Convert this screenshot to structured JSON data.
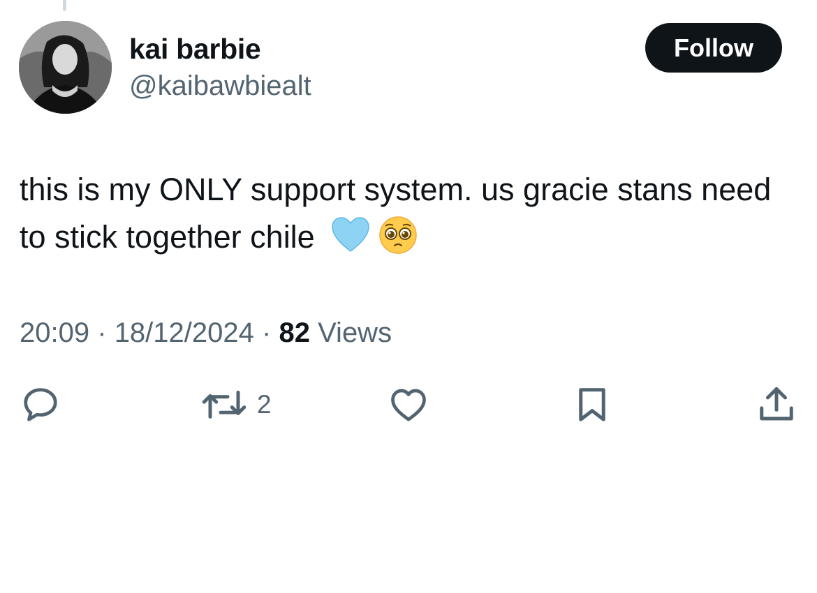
{
  "tweet": {
    "author": {
      "display_name": "kai barbie",
      "handle": "@kaibawbiealt"
    },
    "follow_button_label": "Follow",
    "text": "this is my ONLY support system. us gracie stans need to stick together chile",
    "emojis": [
      "light-blue-heart",
      "pleading-face"
    ],
    "time": "20:09",
    "separator": "·",
    "date": "18/12/2024",
    "views_count": "82",
    "views_label": "Views"
  },
  "actions": {
    "reply_icon": "reply-icon",
    "retweet_icon": "retweet-icon",
    "retweet_count": "2",
    "like_icon": "heart-icon",
    "bookmark_icon": "bookmark-icon",
    "share_icon": "share-icon"
  },
  "colors": {
    "text_primary": "#0f1419",
    "text_secondary": "#536471",
    "follow_bg": "#0f1419",
    "follow_text": "#ffffff"
  }
}
